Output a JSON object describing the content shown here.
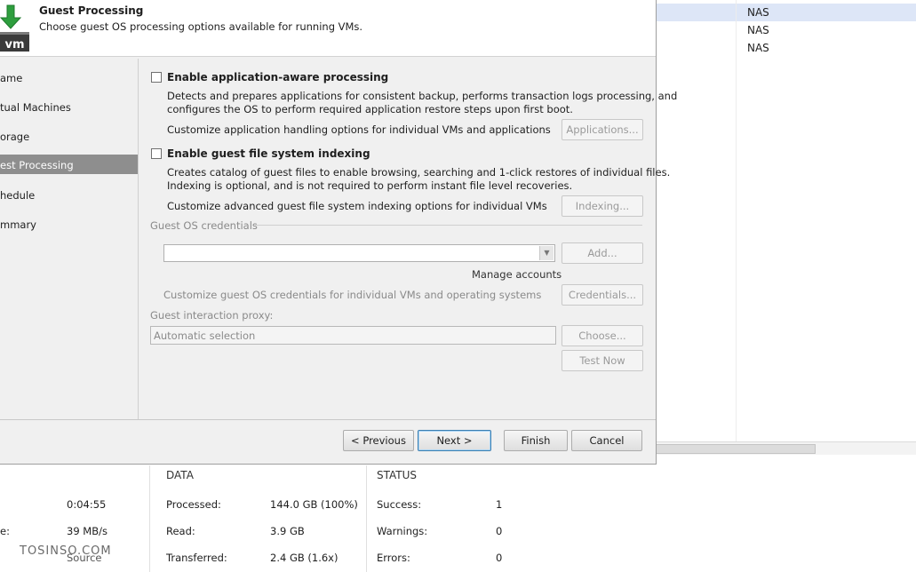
{
  "background_table": {
    "rows": [
      {
        "value": "NAS",
        "selected": true
      },
      {
        "value": "NAS",
        "selected": false
      },
      {
        "value": "NAS",
        "selected": false
      }
    ]
  },
  "stats": {
    "left": {
      "rows": [
        {
          "label": "",
          "value": "0:04:55"
        },
        {
          "label": "e:",
          "value": "39 MB/s"
        },
        {
          "label": "",
          "value": "Source"
        }
      ]
    },
    "data": {
      "header": "DATA",
      "rows": [
        {
          "label": "Processed:",
          "value": "144.0 GB (100%)"
        },
        {
          "label": "Read:",
          "value": "3.9 GB"
        },
        {
          "label": "Transferred:",
          "value": "2.4 GB (1.6x)"
        }
      ]
    },
    "status": {
      "header": "STATUS",
      "rows": [
        {
          "label": "Success:",
          "value": "1"
        },
        {
          "label": "Warnings:",
          "value": "0"
        },
        {
          "label": "Errors:",
          "value": "0"
        }
      ]
    },
    "watermark": "TOSINSO.COM"
  },
  "dialog": {
    "icon": "vm-download-icon",
    "icon_text": "vm",
    "title": "Guest Processing",
    "subtitle": "Choose guest OS processing options available for running VMs.",
    "nav": [
      {
        "label": "ame",
        "active": false
      },
      {
        "label": "tual Machines",
        "active": false
      },
      {
        "label": "orage",
        "active": false
      },
      {
        "label": "est Processing",
        "active": true
      },
      {
        "label": "hedule",
        "active": false
      },
      {
        "label": "mmary",
        "active": false
      }
    ],
    "app_aware": {
      "label": "Enable application-aware processing",
      "checked": false,
      "desc_line1": "Detects and prepares applications for consistent backup, performs transaction logs processing, and",
      "desc_line2": "configures the OS to perform required application restore steps upon first boot.",
      "customize_text": "Customize application handling options for individual VMs and applications",
      "button": "Applications..."
    },
    "indexing": {
      "label": "Enable guest file system indexing",
      "checked": false,
      "desc_line1": "Creates catalog of guest files to enable browsing, searching and 1-click restores of individual files.",
      "desc_line2": "Indexing is optional, and is not required to perform instant file level recoveries.",
      "customize_text": "Customize advanced guest file system indexing options for individual VMs",
      "button": "Indexing..."
    },
    "credentials": {
      "group_label": "Guest OS credentials",
      "selected_value": "",
      "add_button": "Add...",
      "manage_link": "Manage accounts",
      "customize_text": "Customize guest OS credentials for individual VMs and operating systems",
      "button": "Credentials..."
    },
    "proxy": {
      "label": "Guest interaction proxy:",
      "value": "Automatic selection",
      "choose_button": "Choose...",
      "test_button": "Test Now"
    },
    "footer": {
      "previous": "< Previous",
      "next": "Next >",
      "finish": "Finish",
      "cancel": "Cancel"
    }
  }
}
